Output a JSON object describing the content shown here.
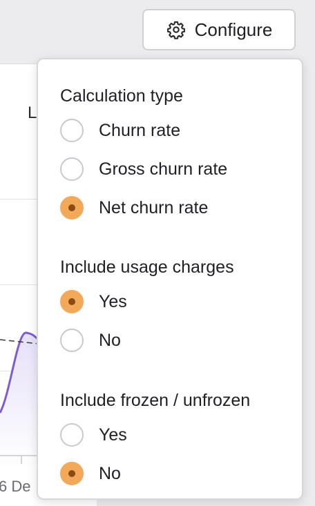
{
  "toolbar": {
    "configure_label": "Configure",
    "configure_icon": "gear-icon"
  },
  "background": {
    "fragment_label": "L",
    "tick_label": "6 De",
    "series_color": "#7e5cd0"
  },
  "popover": {
    "sections": [
      {
        "title": "Calculation type",
        "options": [
          {
            "label": "Churn rate",
            "checked": false
          },
          {
            "label": "Gross churn rate",
            "checked": false
          },
          {
            "label": "Net churn rate",
            "checked": true
          }
        ]
      },
      {
        "title": "Include usage charges",
        "options": [
          {
            "label": "Yes",
            "checked": true
          },
          {
            "label": "No",
            "checked": false
          }
        ]
      },
      {
        "title": "Include frozen / unfrozen",
        "options": [
          {
            "label": "Yes",
            "checked": false
          },
          {
            "label": "No",
            "checked": true
          }
        ]
      }
    ]
  },
  "colors": {
    "accent": "#f2a95a",
    "accent_dot": "#8a4a14",
    "border": "#d7d7dc"
  }
}
